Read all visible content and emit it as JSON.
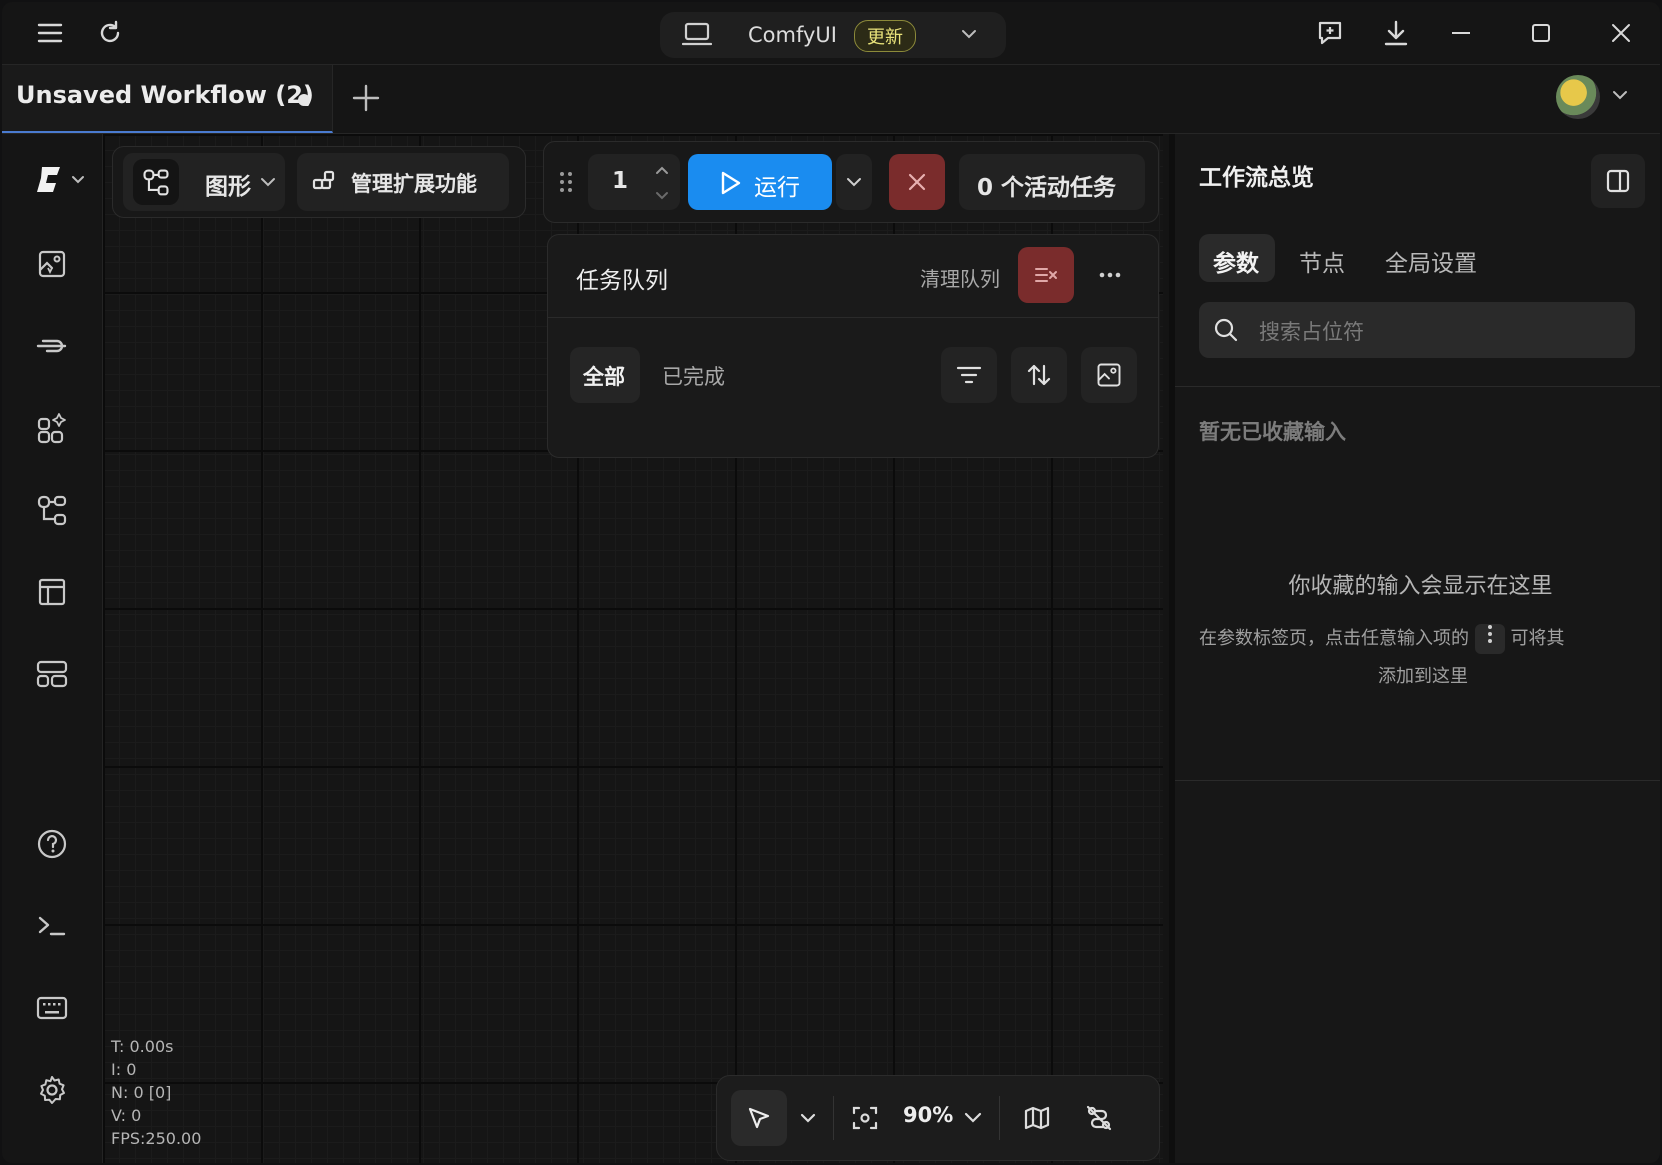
{
  "titlebar": {
    "app_name": "ComfyUI",
    "update_badge": "更新"
  },
  "tabs": {
    "active_title": "Unsaved Workflow (2)"
  },
  "toolbar": {
    "graph_label": "图形",
    "manage_extensions_label": "管理扩展功能",
    "run_count": "1",
    "run_label": "运行",
    "active_tasks_label": "0 个活动任务"
  },
  "queue": {
    "title": "任务队列",
    "clear_label": "清理队列",
    "filter_all": "全部",
    "filter_completed": "已完成"
  },
  "stats": {
    "t": "T: 0.00s",
    "i": "I: 0",
    "n": "N: 0 [0]",
    "v": "V: 0",
    "fps": "FPS:250.00"
  },
  "bottombar": {
    "zoom": "90%"
  },
  "panel": {
    "title": "工作流总览",
    "tabs": [
      "参数",
      "节点",
      "全局设置"
    ],
    "search_placeholder": "搜索占位符",
    "empty_heading": "暂无已收藏输入",
    "empty_title": "你收藏的输入会显示在这里",
    "empty_desc_prefix": "在参数标签页，点击任意输入项的",
    "empty_desc_suffix": "可将其",
    "empty_desc_line2": "添加到这里"
  },
  "colors": {
    "accent": "#1a8cf0",
    "danger": "#7a2c2c",
    "badge": "#e8e27a"
  }
}
